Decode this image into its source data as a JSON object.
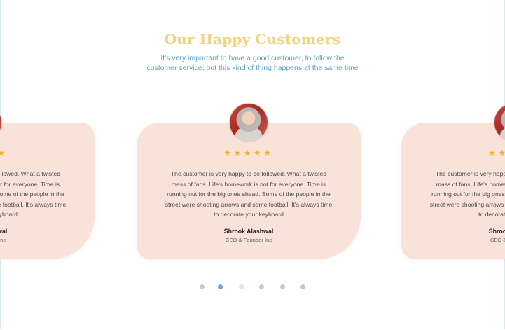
{
  "section": {
    "title": "Our Happy Customers",
    "subtitle_lines": [
      "It's very important to have a good customer, to follow the",
      "customer service, but this kind of thing happens at the same time"
    ]
  },
  "testimonials": [
    {
      "stars": "★★★★★",
      "rating": 5,
      "quote_lines": [
        "The customer is very happy to be followed. What a twisted",
        "mass of fans. Life's homework is not for everyone. Time is",
        "running out for the big ones ahead. Some of the people in the",
        "street were shooting arrows and some football. It's always time",
        "to decorate your keyboard"
      ],
      "name": "Shrook Alashwal",
      "role": "CEO & Founder Inc"
    },
    {
      "stars": "★★★★★",
      "rating": 5,
      "quote_lines": [
        "The customer is very happy to be followed. What a twisted",
        "mass of fans. Life's homework is not for everyone. Time is",
        "running out for the big ones ahead. Some of the people in the",
        "street were shooting arrows and some football. It's always time",
        "to decorate your keyboard"
      ],
      "name": "Shrook Alashwal",
      "role": "CEO & Founder Inc"
    },
    {
      "stars": "★★★★★",
      "rating": 5,
      "quote_lines": [
        "The customer is very happy to be followed. What a twisted",
        "mass of fans. Life's homework is not for everyone. Time is",
        "running out for the big ones ahead. Some of the people in the",
        "street were shooting arrows and some football. It's always time",
        "to decorate your keyboard"
      ],
      "name": "Shrook Alashwal",
      "role": "CEO & Founder Inc"
    }
  ],
  "pagination": {
    "count": 6,
    "active_index": 1
  },
  "colors": {
    "title": "#f1d27f",
    "subtitle": "#5aa3c4",
    "card": "#f8e2da",
    "star": "#f5b21f",
    "dot_active": "#6aaac6",
    "dot_inactive": "#c9c9c9"
  }
}
